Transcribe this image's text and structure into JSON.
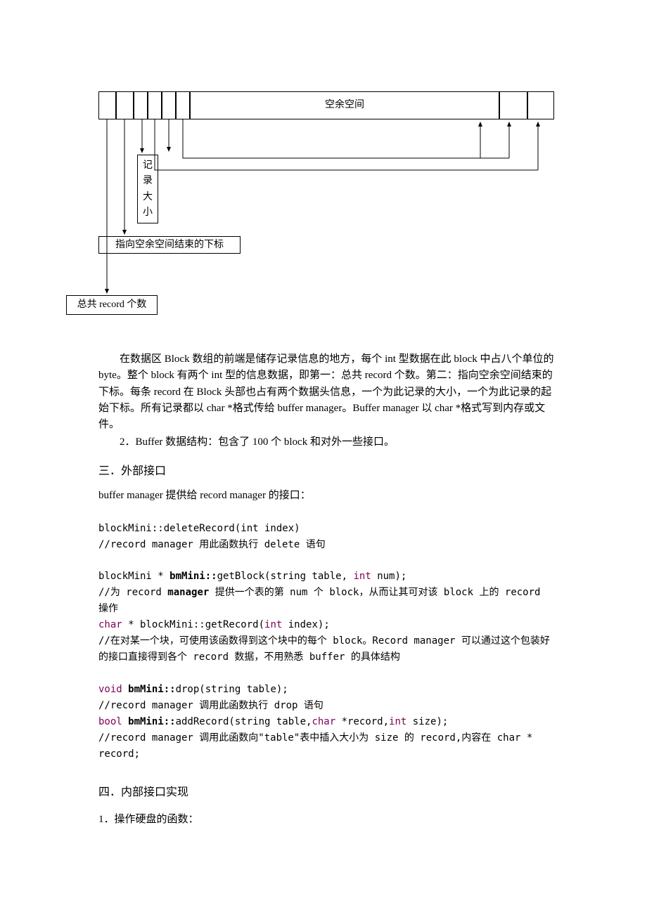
{
  "diagram": {
    "free_space": "空余空间",
    "record_size": "记 录 大 小",
    "end_index": "指向空余空间结束的下标",
    "record_count": "总共 record 个数"
  },
  "body": {
    "p1": "在数据区 Block 数组的前端是储存记录信息的地方，每个 int 型数据在此 block 中占八个单位的 byte。整个 block 有两个 int 型的信息数据，即第一：总共 record 个数。第二：指向空余空间结束的下标。每条 record 在 Block 头部也占有两个数据头信息，一个为此记录的大小，一个为此记录的起始下标。所有记录都以 char *格式传给 buffer manager。Buffer manager 以 char *格式写到内存或文件。",
    "p2": "2．Buffer 数据结构：包含了 100 个 block 和对外一些接口。",
    "h_sec3": "三．外部接口",
    "p3": "buffer manager 提供给 record manager 的接口：",
    "c1": "blockMini::deleteRecord(int index)",
    "c2": "//record manager 用此函数执行 delete 语句",
    "c3": {
      "a": "blockMini * ",
      "cls": "bmMini::",
      "b": "getBlock(string table, ",
      "kw": "int",
      "c": " num);"
    },
    "c4": {
      "a": "//为 record ",
      "cls": "manager",
      "b": " 提供一个表的第 num 个 block，从而让其可对该 block 上的 record 操作"
    },
    "c5": {
      "kw1": "char",
      "a": " * blockMini::getRecord(",
      "kw2": "int",
      "b": " index);"
    },
    "c6": "//在对某一个块，可使用该函数得到这个块中的每个 block。Record manager 可以通过这个包装好的接口直接得到各个 record 数据，不用熟悉 buffer 的具体结构",
    "c7": {
      "kw": "void",
      "cls": " bmMini::",
      "a": "drop(string table);"
    },
    "c8": "//record manager 调用此函数执行 drop 语句",
    "c9": {
      "kw1": "bool",
      "cls": " bmMini::",
      "a": "addRecord(string table,",
      "kw2": "char",
      "b": " *record,",
      "kw3": "int",
      "c": " size);"
    },
    "c10": "//record manager 调用此函数向\"table\"表中插入大小为 size 的 record,内容在 char * record;",
    "h_sec4": "四．内部接口实现",
    "p4": "1．操作硬盘的函数："
  }
}
